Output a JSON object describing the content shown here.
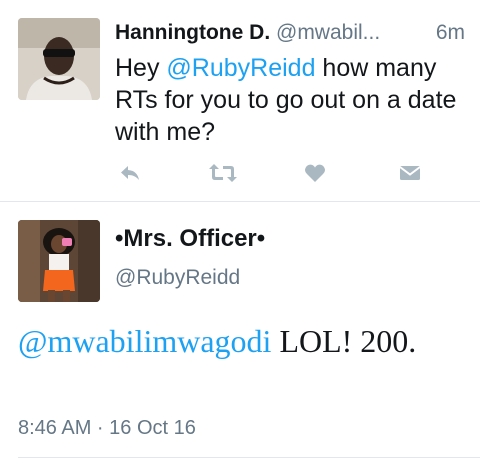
{
  "tweet1": {
    "display_name": "Hanningtone D.",
    "handle": "@mwabil...",
    "time": "6m",
    "text_before": "Hey ",
    "mention": "@RubyReidd",
    "text_after": " how many RTs for you to go out on a date with me?",
    "actions": [
      "reply-icon",
      "retweet-icon",
      "like-icon",
      "dm-icon"
    ]
  },
  "tweet2": {
    "display_name": "•Mrs. Officer•",
    "handle": "@RubyReidd",
    "mention": "@mwabilimwagodi",
    "text_after": " LOL! 200.",
    "timestamp": "8:46 AM · 16 Oct 16"
  },
  "colors": {
    "link": "#1da1f2",
    "secondary_text": "#657786",
    "icon": "#aab8c2",
    "divider": "#e1e8ed"
  }
}
